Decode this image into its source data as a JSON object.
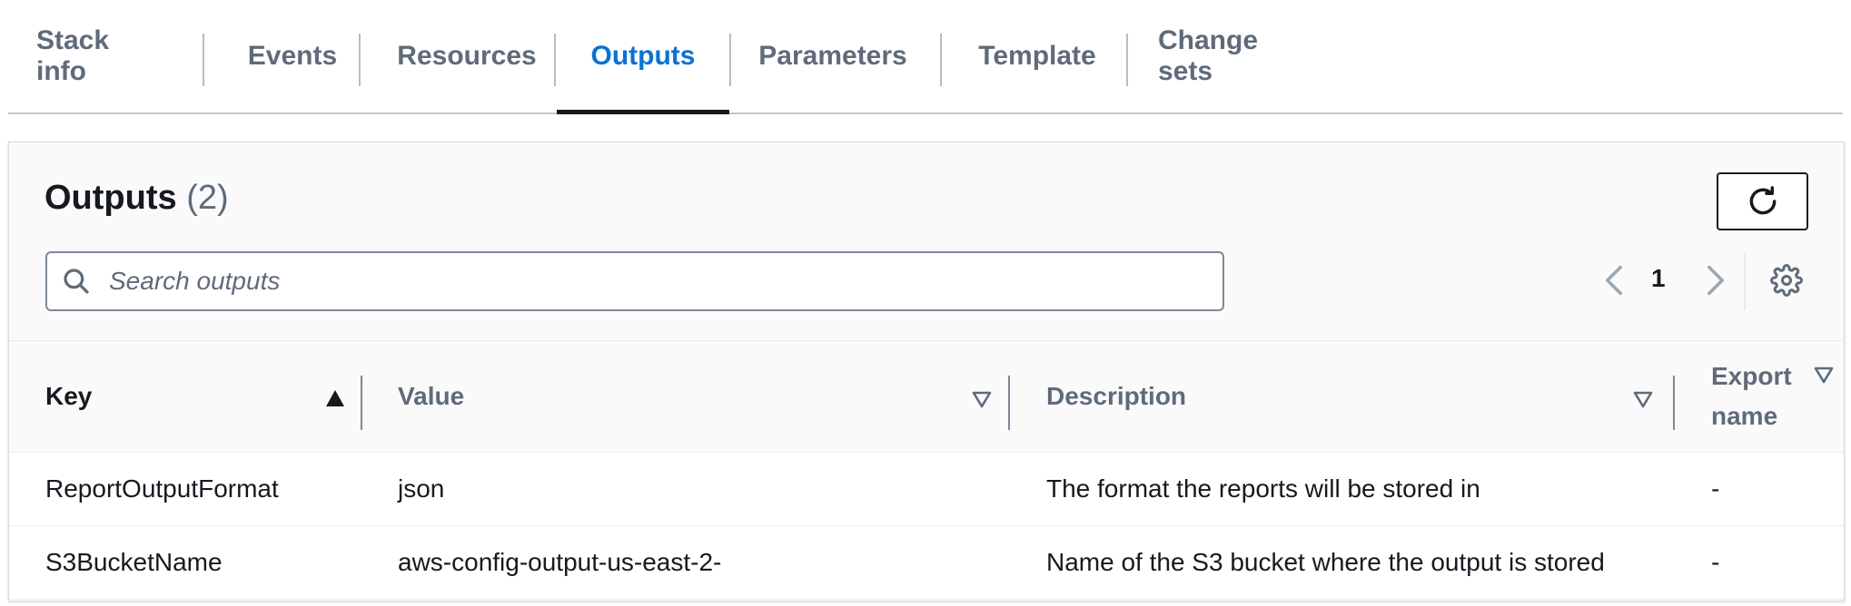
{
  "tabs": [
    {
      "label": "Stack info",
      "active": false
    },
    {
      "label": "Events",
      "active": false
    },
    {
      "label": "Resources",
      "active": false
    },
    {
      "label": "Outputs",
      "active": true
    },
    {
      "label": "Parameters",
      "active": false
    },
    {
      "label": "Template",
      "active": false
    },
    {
      "label": "Change sets",
      "active": false
    }
  ],
  "panel": {
    "title": "Outputs",
    "count": "(2)",
    "refresh_icon": "refresh-icon",
    "search": {
      "placeholder": "Search outputs",
      "value": "",
      "icon": "search-icon"
    },
    "pagination": {
      "current_page": "1",
      "prev_icon": "chevron-left-icon",
      "next_icon": "chevron-right-icon"
    },
    "settings_icon": "gear-icon"
  },
  "table": {
    "columns": [
      {
        "label": "Key",
        "sort": "ascending"
      },
      {
        "label": "Value",
        "sort": "none"
      },
      {
        "label": "Description",
        "sort": "none"
      },
      {
        "label": "Export name",
        "sort": "none"
      }
    ],
    "rows": [
      {
        "key": "ReportOutputFormat",
        "value": "json",
        "description": "The format the reports will be stored in",
        "export_name": "-"
      },
      {
        "key": "S3BucketName",
        "value": "aws-config-output-us-east-2-",
        "description": "Name of the S3 bucket where the output is stored",
        "export_name": "-"
      }
    ]
  },
  "colors": {
    "active_tab": "#0972d3",
    "text": "#16191f",
    "muted": "#5f6b7a"
  }
}
